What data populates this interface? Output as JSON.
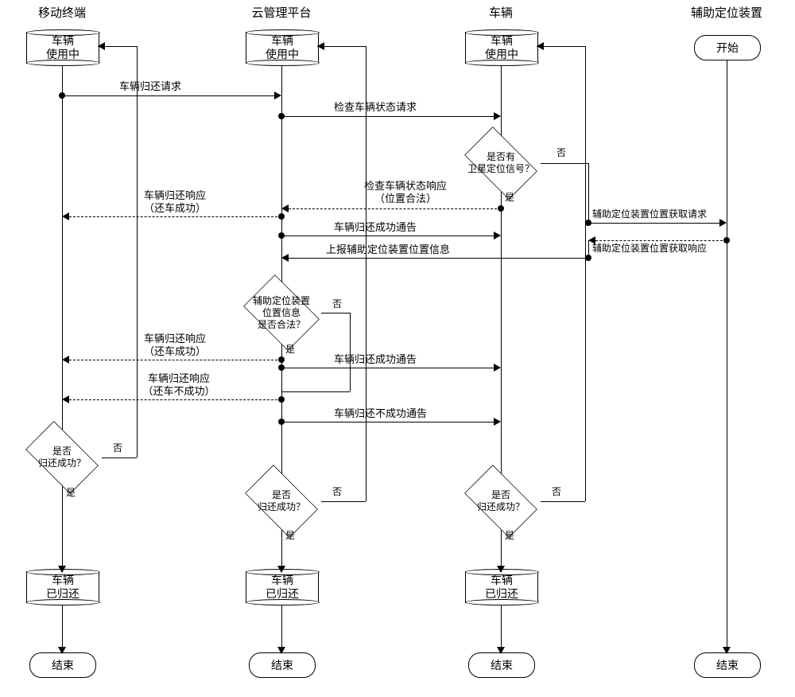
{
  "lanes": {
    "mobile": "移动终端",
    "cloud": "云管理平台",
    "vehicle": "车辆",
    "aux": "辅助定位装置"
  },
  "states": {
    "in_use": "车辆<br>使用中",
    "returned": "车辆<br>已归还",
    "start": "开始",
    "end": "结束"
  },
  "decisions": {
    "has_signal": "是否有<br>卫星定位信号？",
    "aux_legal": "辅助定位装置<br>位置信息<br>是否合法？",
    "return_ok": "是否<br>归还成功？"
  },
  "branches": {
    "yes": "是",
    "no": "否"
  },
  "messages": {
    "m1": "车辆归还请求",
    "m2": "检查车辆状态请求",
    "m3": "检查车辆状态响应<br>（位置合法）",
    "m4": "车辆归还响应<br>（还车成功）",
    "m5": "车辆归还成功通告",
    "m6": "辅助定位装置位置获取请求",
    "m7": "辅助定位装置位置获取响应",
    "m8": "上报辅助定位装置位置信息",
    "m9": "车辆归还响应<br>（还车成功）",
    "m10": "车辆归还成功通告",
    "m11": "车辆归还响应<br>（还车不成功）",
    "m12": "车辆归还不成功通告"
  },
  "chart_data": {
    "type": "sequence-flowchart",
    "lanes": [
      "移动终端",
      "云管理平台",
      "车辆",
      "辅助定位装置"
    ],
    "initial_states": {
      "移动终端": "车辆使用中",
      "云管理平台": "车辆使用中",
      "车辆": "车辆使用中",
      "辅助定位装置": "开始"
    },
    "final_states": {
      "移动终端": "结束",
      "云管理平台": "结束",
      "车辆": "结束",
      "辅助定位装置": "结束"
    },
    "notes": "solid arrows = request/notification, dashed arrows = response",
    "steps": [
      {
        "from": "移动终端",
        "to": "云管理平台",
        "label": "车辆归还请求",
        "style": "solid"
      },
      {
        "from": "云管理平台",
        "to": "车辆",
        "label": "检查车辆状态请求",
        "style": "solid"
      },
      {
        "at": "车辆",
        "decision": "是否有卫星定位信号？",
        "yes": "go_down",
        "no": "request_aux"
      },
      {
        "branch": "yes",
        "from": "车辆",
        "to": "云管理平台",
        "label": "检查车辆状态响应（位置合法）",
        "style": "dashed"
      },
      {
        "branch": "yes",
        "from": "云管理平台",
        "to": "移动终端",
        "label": "车辆归还响应（还车成功）",
        "style": "dashed"
      },
      {
        "branch": "yes",
        "from": "云管理平台",
        "to": "车辆",
        "label": "车辆归还成功通告",
        "style": "solid"
      },
      {
        "branch": "no",
        "from": "车辆",
        "to": "辅助定位装置",
        "label": "辅助定位装置位置获取请求",
        "style": "solid"
      },
      {
        "branch": "no",
        "from": "辅助定位装置",
        "to": "车辆",
        "label": "辅助定位装置位置获取响应",
        "style": "dashed"
      },
      {
        "branch": "no",
        "from": "车辆",
        "to": "云管理平台",
        "label": "上报辅助定位装置位置信息",
        "style": "solid"
      },
      {
        "at": "云管理平台",
        "decision": "辅助定位装置位置信息是否合法？"
      },
      {
        "branch": "yes",
        "from": "云管理平台",
        "to": "移动终端",
        "label": "车辆归还响应（还车成功）",
        "style": "dashed"
      },
      {
        "branch": "yes",
        "from": "云管理平台",
        "to": "车辆",
        "label": "车辆归还成功通告",
        "style": "solid"
      },
      {
        "branch": "no",
        "from": "云管理平台",
        "to": "移动终端",
        "label": "车辆归还响应（还车不成功）",
        "style": "dashed"
      },
      {
        "branch": "no",
        "from": "云管理平台",
        "to": "车辆",
        "label": "车辆归还不成功通告",
        "style": "solid"
      },
      {
        "at": "移动终端",
        "decision": "是否归还成功？",
        "yes": "车辆已归还",
        "no": "返回 车辆使用中"
      },
      {
        "at": "云管理平台",
        "decision": "是否归还成功？",
        "yes": "车辆已归还",
        "no": "返回 车辆使用中"
      },
      {
        "at": "车辆",
        "decision": "是否归还成功？",
        "yes": "车辆已归还",
        "no": "返回 车辆使用中"
      }
    ]
  }
}
